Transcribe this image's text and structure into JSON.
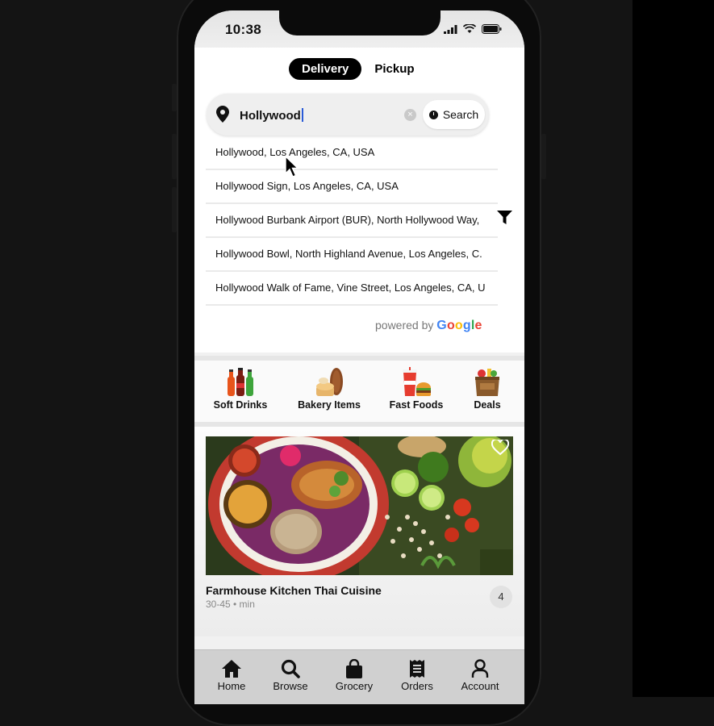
{
  "status_bar": {
    "time": "10:38"
  },
  "mode_toggle": {
    "active": "Delivery",
    "inactive": "Pickup"
  },
  "search": {
    "value": "Hollywood",
    "button_label": "Search"
  },
  "suggestions": [
    "Hollywood, Los Angeles, CA, USA",
    "Hollywood Sign, Los Angeles, CA, USA",
    "Hollywood Burbank Airport (BUR), North Hollywood Way,",
    "Hollywood Bowl, North Highland Avenue, Los Angeles, C.",
    "Hollywood Walk of Fame, Vine Street, Los Angeles, CA, U"
  ],
  "attribution": {
    "prefix": "powered by",
    "brand": "Google"
  },
  "categories": [
    {
      "label": "Soft Drinks",
      "icon": "soft-drinks-icon"
    },
    {
      "label": "Bakery Items",
      "icon": "bakery-icon"
    },
    {
      "label": "Fast Foods",
      "icon": "fast-food-icon"
    },
    {
      "label": "Deals",
      "icon": "deals-bag-icon"
    }
  ],
  "restaurant": {
    "name": "Farmhouse Kitchen Thai Cuisine",
    "meta": "30-45 • min",
    "rating": "4"
  },
  "nav": [
    {
      "label": "Home",
      "icon": "home-icon"
    },
    {
      "label": "Browse",
      "icon": "search-icon"
    },
    {
      "label": "Grocery",
      "icon": "shopping-bag-icon"
    },
    {
      "label": "Orders",
      "icon": "receipt-icon"
    },
    {
      "label": "Account",
      "icon": "user-icon"
    }
  ],
  "colors": {
    "accent": "#000000",
    "nav_bg": "#d0d0d0",
    "background": "#141414"
  }
}
